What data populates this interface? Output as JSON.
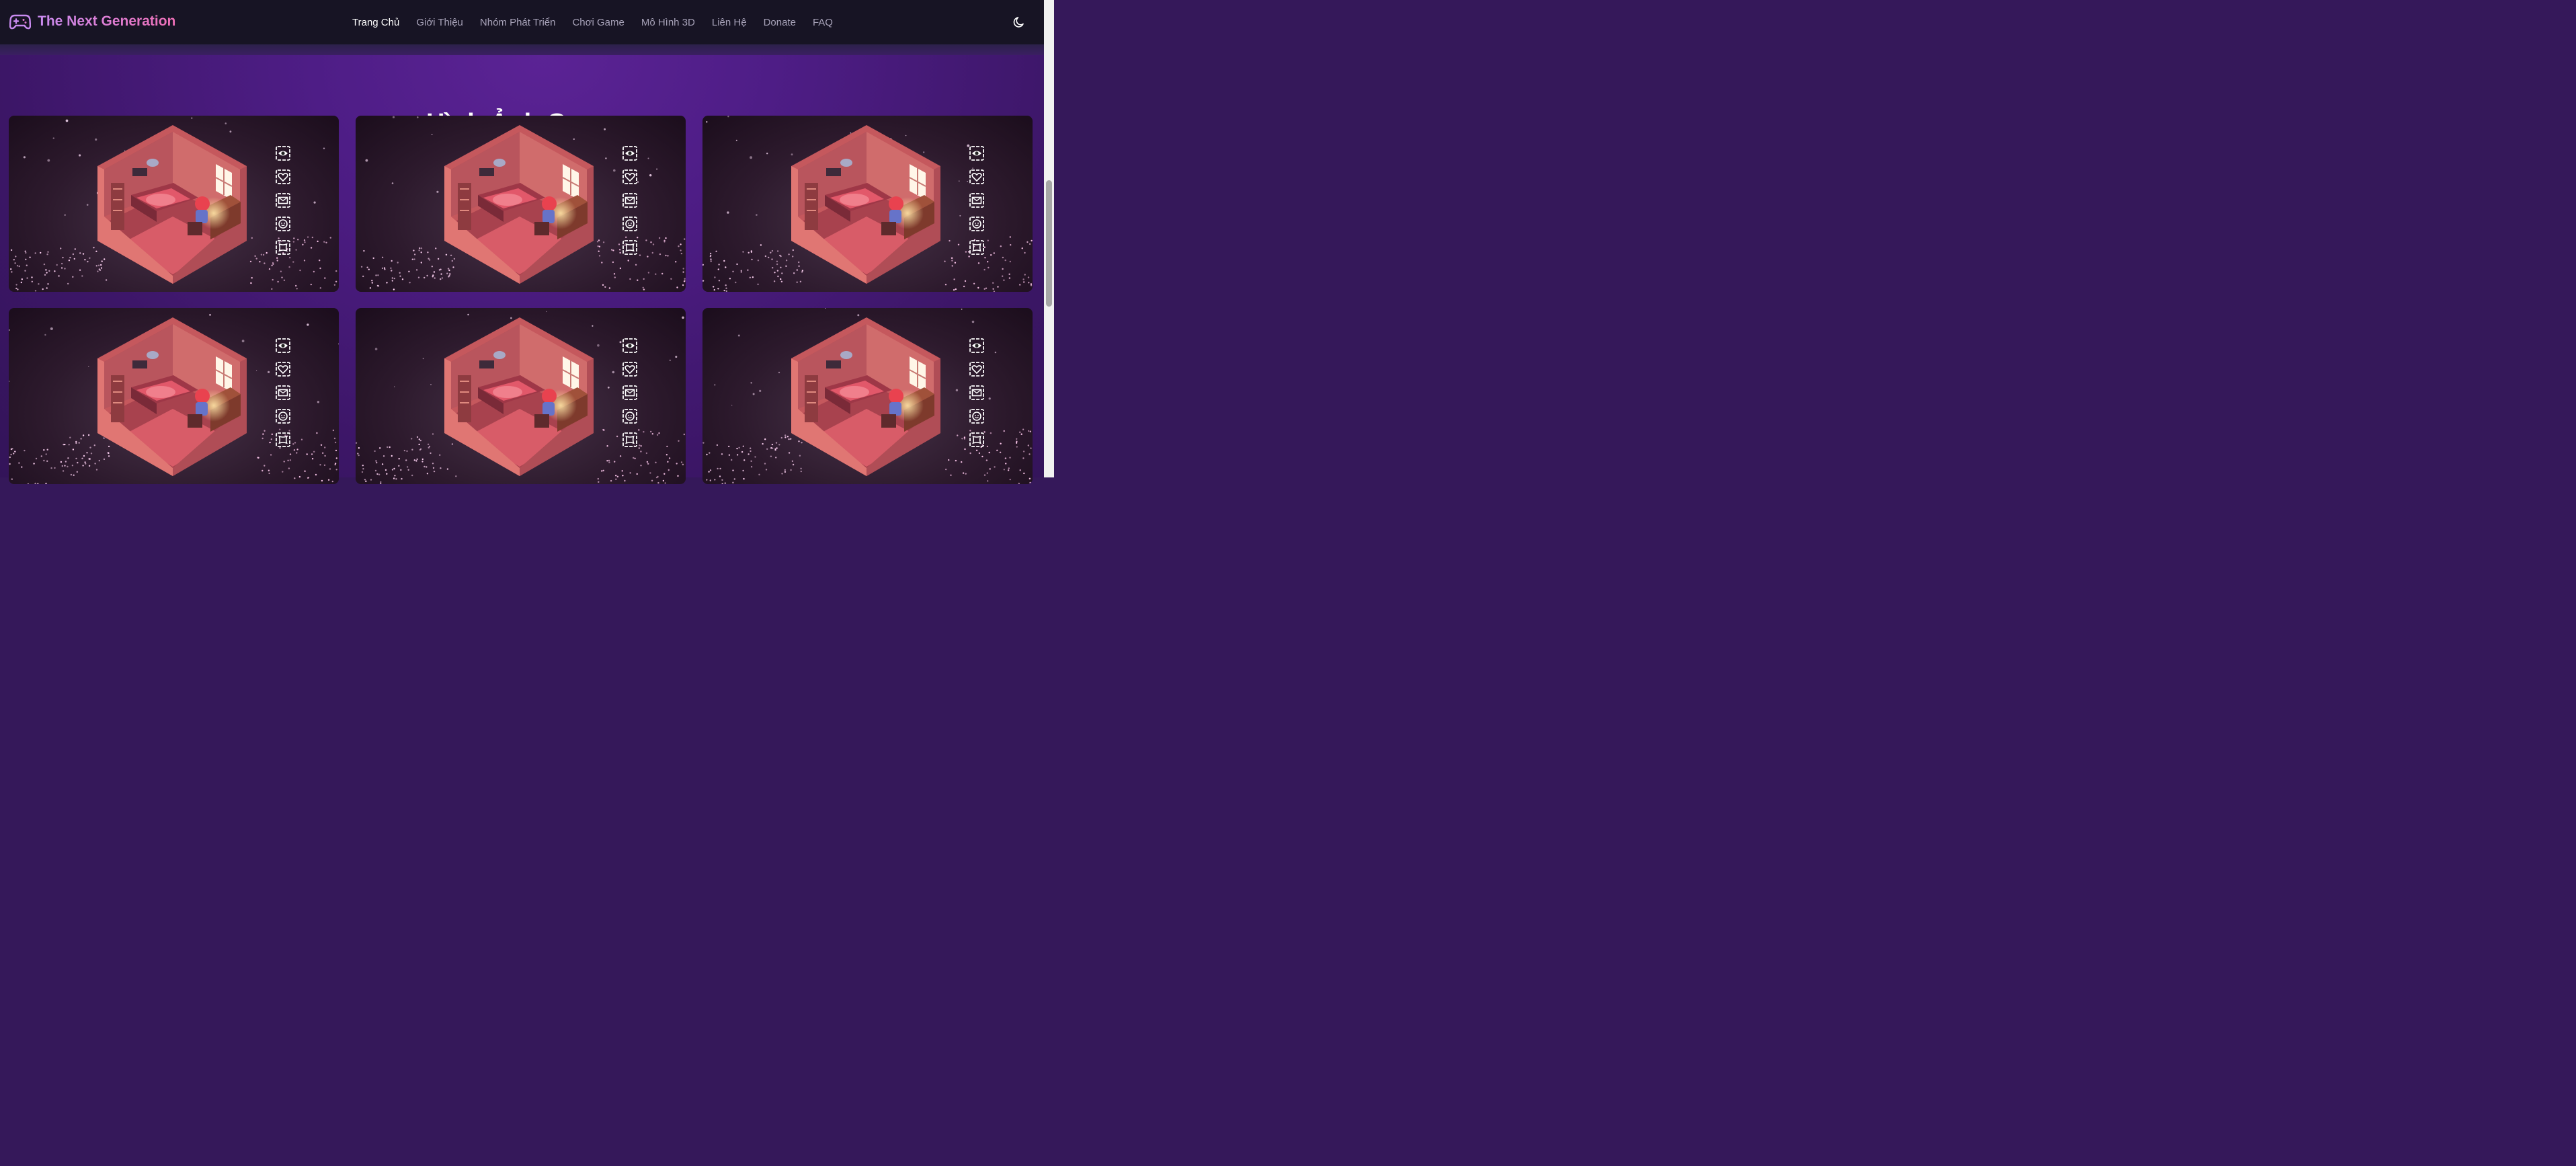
{
  "brand": {
    "name": "The Next Generation",
    "logo_icon": "gamepad-icon",
    "gradient": [
      "#c98bf0",
      "#ee6fb7"
    ]
  },
  "nav": {
    "items": [
      {
        "label": "Trang Chủ",
        "active": true
      },
      {
        "label": "Giới Thiệu",
        "active": false
      },
      {
        "label": "Nhóm Phát Triển",
        "active": false
      },
      {
        "label": "Chơi Game",
        "active": false
      },
      {
        "label": "Mô Hình 3D",
        "active": false
      },
      {
        "label": "Liên Hệ",
        "active": false
      },
      {
        "label": "Donate",
        "active": false
      },
      {
        "label": "FAQ",
        "active": false
      }
    ],
    "theme_toggle_icon": "moon-icon"
  },
  "gallery": {
    "title": "Hình Ảnh Game",
    "card_count": 6,
    "card_icons": [
      "eye-icon",
      "heart-icon",
      "mail-icon",
      "smile-icon",
      "frame-icon"
    ]
  },
  "colors": {
    "navbar": "#171424",
    "section_bg": "#4e1d86",
    "active_link": "#ffffff",
    "link": "#a7a2b8"
  }
}
